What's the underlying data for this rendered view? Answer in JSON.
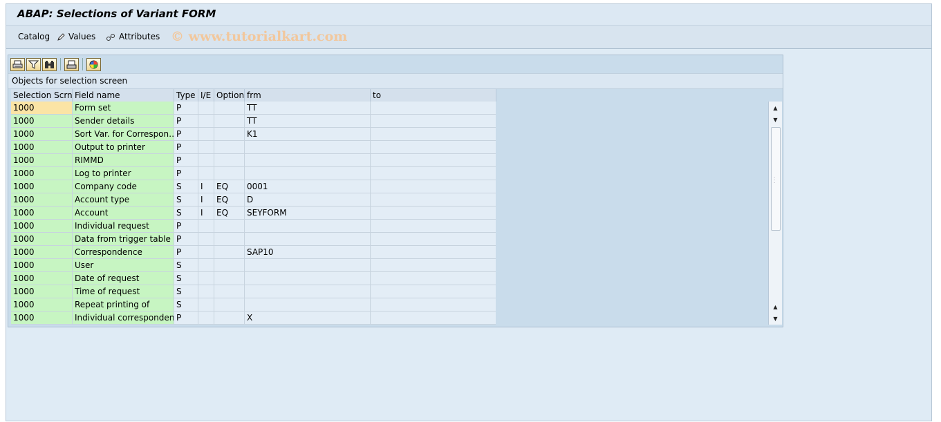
{
  "window": {
    "title": "ABAP: Selections of Variant FORM"
  },
  "appbar": {
    "catalog": "Catalog",
    "values": "Values",
    "attributes": "Attributes",
    "watermark": "© www.tutorialkart.com"
  },
  "toolbar": {
    "icons": [
      "print-preview-icon",
      "filter-icon",
      "find-icon",
      "print-icon",
      "layout-icon"
    ]
  },
  "table": {
    "title": "Objects for selection screen",
    "columns": [
      "Selection Scrns",
      "Field name",
      "Type",
      "I/E",
      "Option",
      "frm",
      "to"
    ],
    "rows": [
      [
        "1000",
        "Form set",
        "P",
        "",
        "",
        "TT",
        ""
      ],
      [
        "1000",
        "Sender details",
        "P",
        "",
        "",
        "TT",
        ""
      ],
      [
        "1000",
        "Sort Var. for Correspon…",
        "P",
        "",
        "",
        "K1",
        ""
      ],
      [
        "1000",
        "Output to printer",
        "P",
        "",
        "",
        "",
        ""
      ],
      [
        "1000",
        "RIMMD",
        "P",
        "",
        "",
        "",
        ""
      ],
      [
        "1000",
        "Log to printer",
        "P",
        "",
        "",
        "",
        ""
      ],
      [
        "1000",
        "Company code",
        "S",
        "I",
        "EQ",
        "0001",
        ""
      ],
      [
        "1000",
        "Account type",
        "S",
        "I",
        "EQ",
        "D",
        ""
      ],
      [
        "1000",
        "Account",
        "S",
        "I",
        "EQ",
        "SEYFORM",
        ""
      ],
      [
        "1000",
        "Individual request",
        "P",
        "",
        "",
        "",
        ""
      ],
      [
        "1000",
        "Data from trigger table",
        "P",
        "",
        "",
        "",
        ""
      ],
      [
        "1000",
        "Correspondence",
        "P",
        "",
        "",
        "SAP10",
        ""
      ],
      [
        "1000",
        "User",
        "S",
        "",
        "",
        "",
        ""
      ],
      [
        "1000",
        "Date of request",
        "S",
        "",
        "",
        "",
        ""
      ],
      [
        "1000",
        "Time of request",
        "S",
        "",
        "",
        "",
        ""
      ],
      [
        "1000",
        "Repeat printing of",
        "S",
        "",
        "",
        "",
        ""
      ],
      [
        "1000",
        "Individual corresponden…",
        "P",
        "",
        "",
        "X",
        ""
      ]
    ]
  }
}
